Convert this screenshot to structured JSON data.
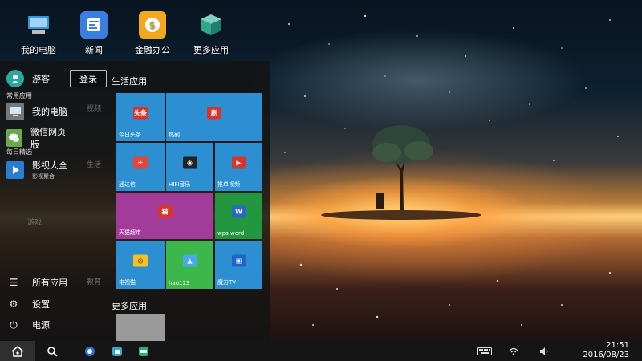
{
  "desktop": {
    "icons": [
      {
        "label": "我的电脑",
        "icon": "computer-icon",
        "color": "#3a95d6"
      },
      {
        "label": "新闻",
        "icon": "news-icon",
        "color": "#3b7de0"
      },
      {
        "label": "金融办公",
        "icon": "coin-icon",
        "color": "#f2a91f"
      },
      {
        "label": "更多应用",
        "icon": "box-icon",
        "color": "#2fa58c"
      }
    ]
  },
  "start_menu": {
    "user": {
      "name": "游客",
      "login_label": "登录"
    },
    "tiles_title": "生活应用",
    "sections": {
      "common": "常用应用",
      "daily": "每日精选"
    },
    "left_apps": [
      {
        "label": "我的电脑",
        "icon": "computer-icon",
        "color": "#777777"
      },
      {
        "label": "微信网页版",
        "icon": "wechat-icon",
        "color": "#6aa84f"
      },
      {
        "label": "影视大全",
        "sub": "影视聚合",
        "icon": "video-icon",
        "color": "#2a7dd1"
      }
    ],
    "bottom_items": [
      {
        "label": "所有应用",
        "icon": "list-icon",
        "glyph": "☰"
      },
      {
        "label": "设置",
        "icon": "gear-icon",
        "glyph": "⚙"
      },
      {
        "label": "电源",
        "icon": "power-icon",
        "glyph": "⏻"
      }
    ],
    "ghost_labels": [
      "视频",
      "生活",
      "游戏",
      "教育"
    ],
    "tiles": [
      {
        "label": "今日头条",
        "icon": "toutiao-icon",
        "glyph": "头条",
        "color": "blue",
        "glyph_bg": "#d9332b"
      },
      {
        "label": "热剧",
        "icon": "hot-drama-icon",
        "glyph": "剧",
        "color": "blue",
        "glyph_bg": "#d9332b"
      },
      {
        "label": "通达信",
        "icon": "tongdaxin-icon",
        "glyph": "✈",
        "color": "blue",
        "glyph_bg": "#e6463a"
      },
      {
        "label": "HIFI音乐",
        "icon": "hifi-music-icon",
        "glyph": "◉",
        "color": "blue",
        "glyph_bg": "#222222"
      },
      {
        "label": "推单视频",
        "icon": "tuidan-video-icon",
        "glyph": "▶",
        "color": "blue",
        "glyph_bg": "#d9332b"
      },
      {
        "label": "天猫超市",
        "icon": "tmall-icon",
        "glyph": "猫",
        "color": "purple",
        "glyph_bg": "#d9332b"
      },
      {
        "label": "wps word",
        "icon": "wps-word-icon",
        "glyph": "W",
        "color": "green",
        "glyph_bg": "#2a67c9"
      },
      {
        "label": "电视猫",
        "icon": "tv-cat-icon",
        "glyph": "◎",
        "color": "blue",
        "glyph_bg": "#f5c024"
      },
      {
        "label": "hao123",
        "icon": "hao123-icon",
        "glyph": "▲",
        "color": "lime",
        "glyph_bg": "#4aa7e8"
      },
      {
        "label": "魔力TV",
        "icon": "moli-tv-icon",
        "glyph": "▣",
        "color": "blue",
        "glyph_bg": "#1d66c9"
      }
    ],
    "more_title": "更多应用"
  },
  "taskbar": {
    "time": "21:51",
    "date": "2016/08/23",
    "apps": [
      {
        "icon": "browser-app-icon",
        "color": "#2d6fd1"
      },
      {
        "icon": "store-app-icon",
        "color": "#30a8c9"
      },
      {
        "icon": "chat-app-icon",
        "color": "#2bb56a"
      }
    ]
  }
}
